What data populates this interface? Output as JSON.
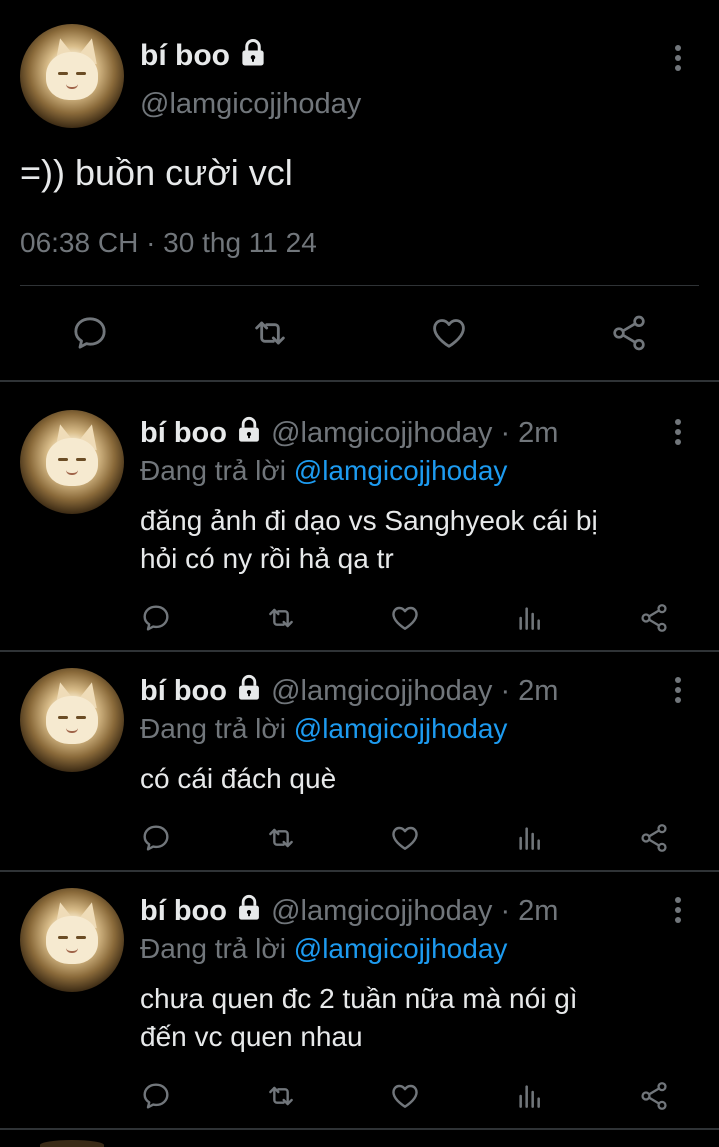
{
  "main_tweet": {
    "name": "bí boo",
    "handle": "@lamgicojjhoday",
    "text": "=)) buồn cười vcl",
    "timestamp": "06:38 CH · 30 thg 11 24"
  },
  "replies": [
    {
      "name": "bí boo",
      "handle": "@lamgicojjhoday",
      "time": "· 2m",
      "replying_prefix": "Đang trả lời",
      "replying_to": "@lamgicojjhoday",
      "line1": "đăng ảnh đi dạo vs Sanghyeok cái bị",
      "line2": "hỏi có ny rồi hả qa tr"
    },
    {
      "name": "bí boo",
      "handle": "@lamgicojjhoday",
      "time": "· 2m",
      "replying_prefix": "Đang trả lời",
      "replying_to": "@lamgicojjhoday",
      "line1": "có cái đách què",
      "line2": ""
    },
    {
      "name": "bí boo",
      "handle": "@lamgicojjhoday",
      "time": "· 2m",
      "replying_prefix": "Đang trả lời",
      "replying_to": "@lamgicojjhoday",
      "line1": "chưa quen đc 2 tuần nữa mà nói gì",
      "line2": "đến vc quen nhau"
    }
  ],
  "colors": {
    "background": "#000000",
    "text": "#e7e9ea",
    "muted": "#71767b",
    "link": "#1d9bf0"
  },
  "icons": [
    "more-icon",
    "lock-icon",
    "reply-icon",
    "retweet-icon",
    "like-icon",
    "views-icon",
    "share-icon"
  ]
}
